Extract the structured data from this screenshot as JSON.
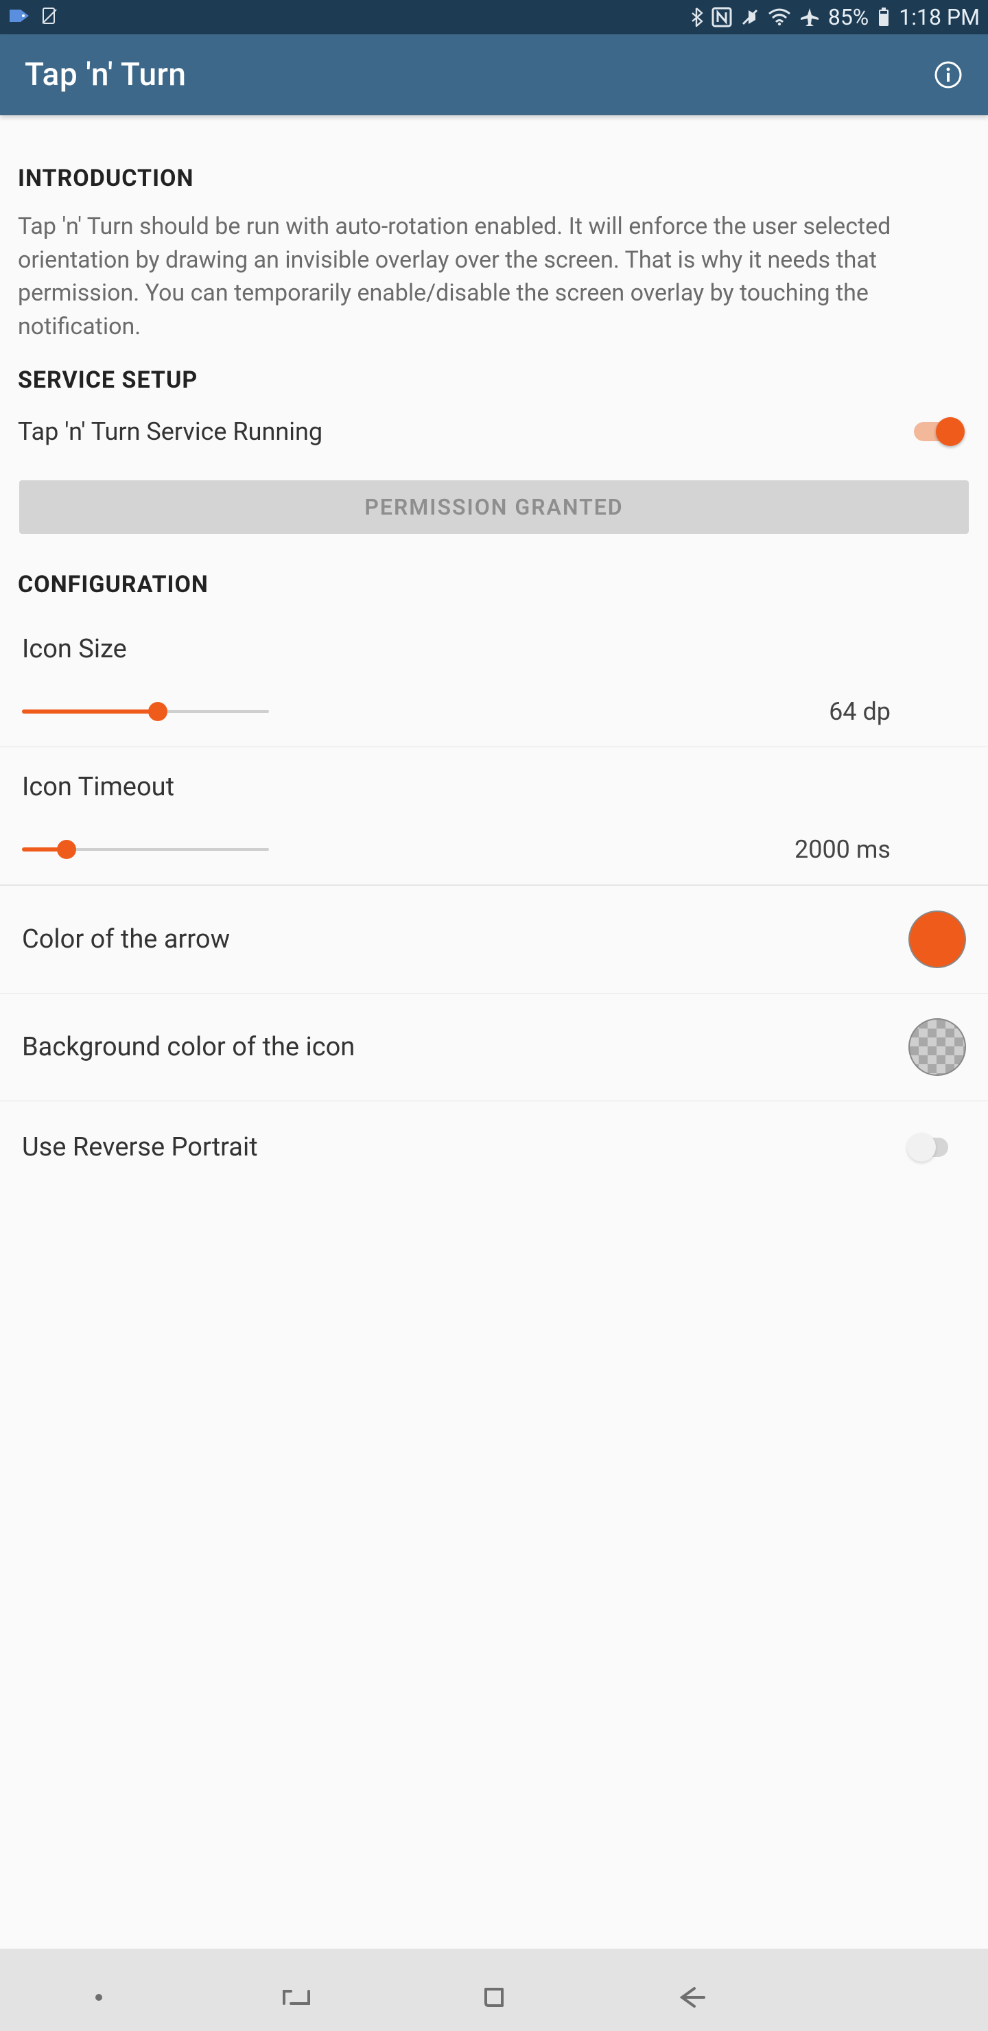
{
  "status": {
    "battery_pct": "85%",
    "time": "1:18 PM"
  },
  "app_bar": {
    "title": "Tap 'n' Turn"
  },
  "sections": {
    "introduction": {
      "header": "INTRODUCTION",
      "body": "Tap 'n' Turn should be run with auto-rotation enabled. It will enforce the user selected orientation by drawing an invisible overlay over the screen. That is why it needs that permission. You can temporarily enable/disable the screen overlay by touching the notification."
    },
    "service_setup": {
      "header": "SERVICE SETUP",
      "running_label": "Tap 'n' Turn Service Running",
      "running_on": true,
      "permission_button": "PERMISSION GRANTED"
    },
    "configuration": {
      "header": "CONFIGURATION",
      "icon_size": {
        "label": "Icon Size",
        "value": "64 dp",
        "percent": 55
      },
      "icon_timeout": {
        "label": "Icon Timeout",
        "value": "2000 ms",
        "percent": 18
      },
      "arrow_color": {
        "label": "Color of the arrow",
        "value_hex": "#ef5b1a"
      },
      "background_color": {
        "label": "Background color of the icon",
        "value": "transparent"
      },
      "reverse_portrait": {
        "label": "Use Reverse Portrait",
        "on": false
      }
    }
  }
}
